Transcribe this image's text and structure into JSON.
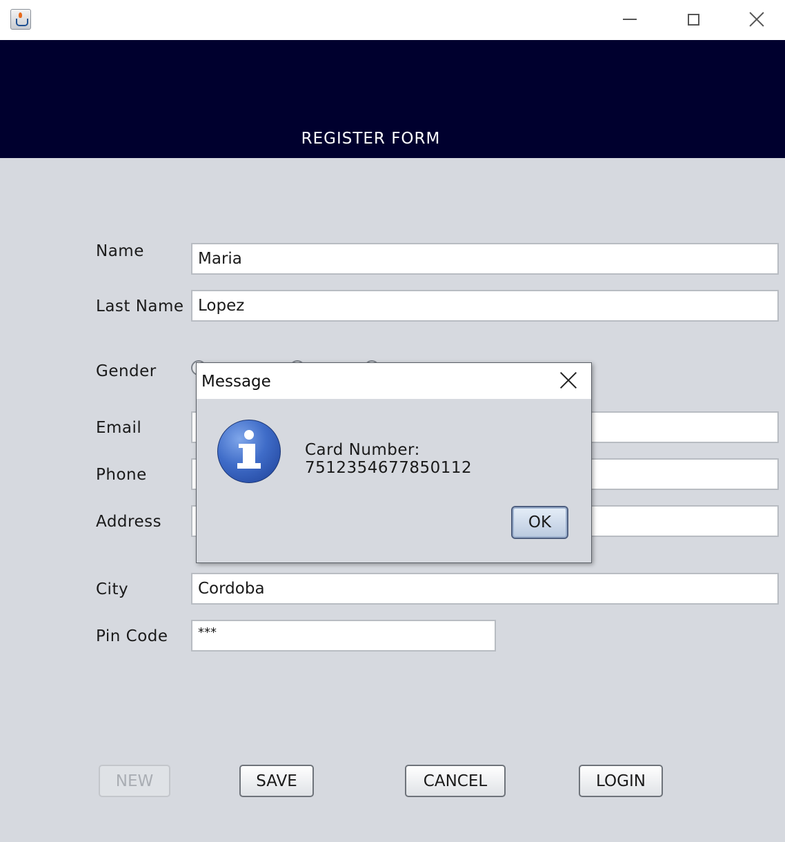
{
  "window": {
    "app_icon": "java-icon"
  },
  "header": {
    "title": "REGISTER FORM",
    "background": "#00002e"
  },
  "form": {
    "name_label": "Name",
    "name_value": "Maria",
    "lastname_label": "Last Name",
    "lastname_value": "Lopez",
    "gender_label": "Gender",
    "email_label": "Email",
    "email_value": "",
    "phone_label": "Phone",
    "phone_value": "",
    "address_label": "Address",
    "address_value": "",
    "city_label": "City",
    "city_value": "Cordoba",
    "pin_label": "Pin Code",
    "pin_value": "***"
  },
  "buttons": {
    "new": "NEW",
    "save": "SAVE",
    "cancel": "CANCEL",
    "login": "LOGIN"
  },
  "dialog": {
    "title": "Message",
    "icon": "info-icon",
    "message": "Card Number: 7512354677850112",
    "ok": "OK"
  }
}
